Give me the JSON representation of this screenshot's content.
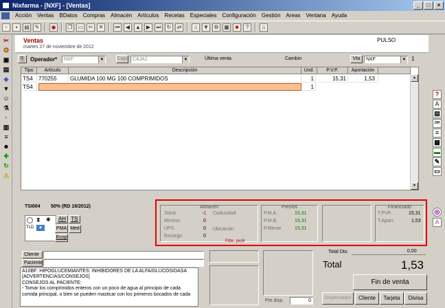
{
  "window": {
    "title": "Nixfarma - [NXF] - [Ventas]"
  },
  "menu": [
    "Acción",
    "Ventas",
    "BDatos",
    "Compras",
    "Almacén",
    "Artículos",
    "Recetas",
    "Especiales",
    "Configuración",
    "Gestión",
    "Areas",
    "Ventana",
    "Ayuda"
  ],
  "header": {
    "title": "Ventas",
    "date": "martes 27 de noviembre de 2012",
    "pulso": "PULSO"
  },
  "controls": {
    "operador_label": "Operador*",
    "operador_value": "NXF",
    "caja_button": "Caja",
    "caja_value": "CAJA1",
    "ultima_venta": "Última venta",
    "cambio": "Cambio",
    "via_button": "Vta",
    "via_value": "NXF",
    "counter": "1"
  },
  "grid": {
    "headers": [
      "Tipo",
      "Artículo",
      "Descripción",
      "Und.",
      "P.V.P.",
      "Aportación"
    ],
    "rows": [
      {
        "tipo": "TS4",
        "articulo": "770255",
        "descripcion": "GLUMIDA 100 MG 100 COMPRIMIDOS",
        "und": "1",
        "pvp": "15,31",
        "aportacion": "1,53"
      },
      {
        "tipo": "TS4",
        "articulo": "",
        "descripcion": "",
        "und": "1",
        "pvp": "",
        "aportacion": ""
      }
    ]
  },
  "product": {
    "code": "TSI004",
    "pct": "50% (RD 16/2012)",
    "buttons": [
      "AH",
      "TS",
      "PMA",
      "Med",
      "Ecop"
    ],
    "tlabel": "TLD"
  },
  "stock": {
    "almacen": {
      "caption": "Almacén",
      "stock_label": "Stock",
      "stock_value": "-1",
      "minimo_label": "Mínimo",
      "minimo_value": "0",
      "ups_label": "UPS.",
      "ups_value": "0",
      "encargo_label": "Encargo",
      "encargo_value": "0",
      "caducidad": "Caducidad",
      "ubicacion": "Ubicación",
      "pdte": "Pdte. pedir"
    },
    "precios": {
      "caption": "Precios",
      "pma_label": "P.M.A.",
      "pma_value": "15,31",
      "pmb_label": "P.M.B.",
      "pmb_value": "15,31",
      "pmenor_label": "P.Menor",
      "pmenor_value": "15,31"
    },
    "financiado": {
      "caption": "Financiado",
      "tpvp_label": "T.PVP.",
      "tpvp_value": "15,31",
      "taport_label": "T.Aport.",
      "taport_value": "1,53"
    }
  },
  "bottom": {
    "cliente_label": "Cliente",
    "paciente_label": "Paciente",
    "advice": [
      "A10BF: HIPOGLUCEMIANTES: INHIBIDORES DE LA ALFA/GLUCOSIDASA",
      "[ADVERTENCIAS/CONSEJOS]",
      "CONSEJOS AL PACIENTE:",
      "- Tomar los comprimidos enteros con un poco de agua al principio de cada",
      "comida principal, o bien se pueden masticar con los primeros bocados de cada"
    ],
    "pte_disp_label": "Pte.disp.",
    "pte_disp_value": "0",
    "total_dto_label": "Total Dto.",
    "total_dto_value": "0,00",
    "total_label": "Total",
    "total_value": "1,53",
    "fin_venta": "Fin de venta",
    "dispensador": "Dispensador",
    "cliente_btn": "Cliente",
    "tarjeta_btn": "Tarjeta",
    "divisa_btn": "Divisa"
  }
}
